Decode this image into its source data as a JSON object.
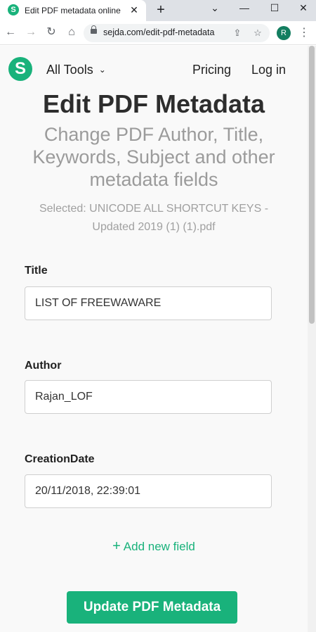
{
  "browser": {
    "tab_title": "Edit PDF metadata online",
    "tab_favicon_letter": "S",
    "tab_close": "✕",
    "new_tab": "+",
    "window_controls": [
      "⌄",
      "—",
      "☐",
      "✕"
    ],
    "url": "sejda.com/edit-pdf-metadata",
    "profile_initial": "R",
    "menu": "⋮",
    "back": "←",
    "forward": "→",
    "reload": "↻",
    "home": "⌂",
    "share": "⇪",
    "star": "☆"
  },
  "header": {
    "logo_letter": "S",
    "all_tools": "All Tools",
    "chevron": "⌄",
    "pricing": "Pricing",
    "login": "Log in"
  },
  "main": {
    "title": "Edit PDF Metadata",
    "subtitle": "Change PDF Author, Title, Keywords, Subject and other metadata fields",
    "selected_file": "Selected: UNICODE ALL SHORTCUT KEYS - Updated 2019 (1) (1).pdf",
    "fields": [
      {
        "label": "Title",
        "value": "LIST OF FREEWAWARE"
      },
      {
        "label": "Author",
        "value": "Rajan_LOF"
      },
      {
        "label": "CreationDate",
        "value": "20/11/2018, 22:39:01"
      }
    ],
    "add_field_plus": "+",
    "add_field": "Add new field",
    "update_button": "Update PDF Metadata"
  },
  "colors": {
    "brand": "#19b27b",
    "profile": "#137e60",
    "page_bg": "#f9f9f9"
  }
}
